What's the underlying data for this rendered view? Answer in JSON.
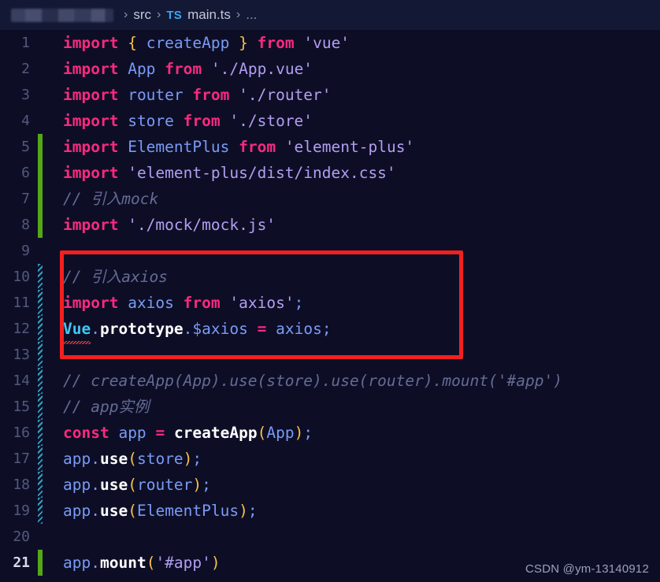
{
  "breadcrumb": {
    "redacted_label": "",
    "separator": "›",
    "folder": "src",
    "file_icon_label": "TS",
    "file": "main.ts",
    "overflow": "..."
  },
  "editor": {
    "language": "typescript",
    "active_line": 21,
    "lines": [
      {
        "n": "1",
        "gutter": "none",
        "tokens": [
          {
            "t": "import",
            "c": "kw"
          },
          {
            "t": " ",
            "c": "plain"
          },
          {
            "t": "{",
            "c": "brace"
          },
          {
            "t": " ",
            "c": "plain"
          },
          {
            "t": "createApp",
            "c": "ident"
          },
          {
            "t": " ",
            "c": "plain"
          },
          {
            "t": "}",
            "c": "brace"
          },
          {
            "t": " ",
            "c": "plain"
          },
          {
            "t": "from",
            "c": "kw"
          },
          {
            "t": " ",
            "c": "plain"
          },
          {
            "t": "'vue'",
            "c": "str"
          }
        ]
      },
      {
        "n": "2",
        "gutter": "none",
        "tokens": [
          {
            "t": "import",
            "c": "kw"
          },
          {
            "t": " ",
            "c": "plain"
          },
          {
            "t": "App",
            "c": "ident"
          },
          {
            "t": " ",
            "c": "plain"
          },
          {
            "t": "from",
            "c": "kw"
          },
          {
            "t": " ",
            "c": "plain"
          },
          {
            "t": "'./App.vue'",
            "c": "str"
          }
        ]
      },
      {
        "n": "3",
        "gutter": "none",
        "tokens": [
          {
            "t": "import",
            "c": "kw"
          },
          {
            "t": " ",
            "c": "plain"
          },
          {
            "t": "router",
            "c": "ident"
          },
          {
            "t": " ",
            "c": "plain"
          },
          {
            "t": "from",
            "c": "kw"
          },
          {
            "t": " ",
            "c": "plain"
          },
          {
            "t": "'./router'",
            "c": "str"
          }
        ]
      },
      {
        "n": "4",
        "gutter": "none",
        "tokens": [
          {
            "t": "import",
            "c": "kw"
          },
          {
            "t": " ",
            "c": "plain"
          },
          {
            "t": "store",
            "c": "ident"
          },
          {
            "t": " ",
            "c": "plain"
          },
          {
            "t": "from",
            "c": "kw"
          },
          {
            "t": " ",
            "c": "plain"
          },
          {
            "t": "'./store'",
            "c": "str"
          }
        ]
      },
      {
        "n": "5",
        "gutter": "added",
        "tokens": [
          {
            "t": "import",
            "c": "kw"
          },
          {
            "t": " ",
            "c": "plain"
          },
          {
            "t": "ElementPlus",
            "c": "ident"
          },
          {
            "t": " ",
            "c": "plain"
          },
          {
            "t": "from",
            "c": "kw"
          },
          {
            "t": " ",
            "c": "plain"
          },
          {
            "t": "'element-plus'",
            "c": "str"
          }
        ]
      },
      {
        "n": "6",
        "gutter": "added",
        "tokens": [
          {
            "t": "import",
            "c": "kw"
          },
          {
            "t": " ",
            "c": "plain"
          },
          {
            "t": "'element-plus/dist/index.css'",
            "c": "str"
          }
        ]
      },
      {
        "n": "7",
        "gutter": "added",
        "tokens": [
          {
            "t": "// 引入mock",
            "c": "comment"
          }
        ]
      },
      {
        "n": "8",
        "gutter": "added",
        "tokens": [
          {
            "t": "import",
            "c": "kw"
          },
          {
            "t": " ",
            "c": "plain"
          },
          {
            "t": "'./mock/mock.js'",
            "c": "str"
          }
        ]
      },
      {
        "n": "9",
        "gutter": "none",
        "tokens": []
      },
      {
        "n": "10",
        "gutter": "modified",
        "tokens": [
          {
            "t": "// 引入axios",
            "c": "comment"
          }
        ]
      },
      {
        "n": "11",
        "gutter": "modified",
        "tokens": [
          {
            "t": "import",
            "c": "kw"
          },
          {
            "t": " ",
            "c": "plain"
          },
          {
            "t": "axios",
            "c": "ident"
          },
          {
            "t": " ",
            "c": "plain"
          },
          {
            "t": "from",
            "c": "kw"
          },
          {
            "t": " ",
            "c": "plain"
          },
          {
            "t": "'axios'",
            "c": "str"
          },
          {
            "t": ";",
            "c": "punct"
          }
        ]
      },
      {
        "n": "12",
        "gutter": "modified",
        "tokens": [
          {
            "t": "Vue",
            "c": "cyan",
            "err": true
          },
          {
            "t": ".",
            "c": "punct"
          },
          {
            "t": "prototype",
            "c": "meth"
          },
          {
            "t": ".",
            "c": "punct"
          },
          {
            "t": "$axios",
            "c": "ident"
          },
          {
            "t": " ",
            "c": "plain"
          },
          {
            "t": "=",
            "c": "op"
          },
          {
            "t": " ",
            "c": "plain"
          },
          {
            "t": "axios",
            "c": "ident"
          },
          {
            "t": ";",
            "c": "punct"
          }
        ]
      },
      {
        "n": "13",
        "gutter": "modified",
        "tokens": []
      },
      {
        "n": "14",
        "gutter": "modified",
        "tokens": [
          {
            "t": "// createApp(App).use(store).use(router).mount('#app')",
            "c": "comment"
          }
        ]
      },
      {
        "n": "15",
        "gutter": "modified",
        "tokens": [
          {
            "t": "// app实例",
            "c": "comment"
          }
        ]
      },
      {
        "n": "16",
        "gutter": "modified",
        "tokens": [
          {
            "t": "const",
            "c": "kw"
          },
          {
            "t": " ",
            "c": "plain"
          },
          {
            "t": "app",
            "c": "ident"
          },
          {
            "t": " ",
            "c": "plain"
          },
          {
            "t": "=",
            "c": "op"
          },
          {
            "t": " ",
            "c": "plain"
          },
          {
            "t": "createApp",
            "c": "fn"
          },
          {
            "t": "(",
            "c": "paren"
          },
          {
            "t": "App",
            "c": "ident"
          },
          {
            "t": ")",
            "c": "paren"
          },
          {
            "t": ";",
            "c": "punct"
          }
        ]
      },
      {
        "n": "17",
        "gutter": "modified",
        "tokens": [
          {
            "t": "app",
            "c": "ident"
          },
          {
            "t": ".",
            "c": "punct"
          },
          {
            "t": "use",
            "c": "meth"
          },
          {
            "t": "(",
            "c": "paren"
          },
          {
            "t": "store",
            "c": "ident"
          },
          {
            "t": ")",
            "c": "paren"
          },
          {
            "t": ";",
            "c": "punct"
          }
        ]
      },
      {
        "n": "18",
        "gutter": "modified",
        "tokens": [
          {
            "t": "app",
            "c": "ident"
          },
          {
            "t": ".",
            "c": "punct"
          },
          {
            "t": "use",
            "c": "meth"
          },
          {
            "t": "(",
            "c": "paren"
          },
          {
            "t": "router",
            "c": "ident"
          },
          {
            "t": ")",
            "c": "paren"
          },
          {
            "t": ";",
            "c": "punct"
          }
        ]
      },
      {
        "n": "19",
        "gutter": "modified",
        "tokens": [
          {
            "t": "app",
            "c": "ident"
          },
          {
            "t": ".",
            "c": "punct"
          },
          {
            "t": "use",
            "c": "meth"
          },
          {
            "t": "(",
            "c": "paren"
          },
          {
            "t": "ElementPlus",
            "c": "ident"
          },
          {
            "t": ")",
            "c": "paren"
          },
          {
            "t": ";",
            "c": "punct"
          }
        ]
      },
      {
        "n": "20",
        "gutter": "none",
        "tokens": []
      },
      {
        "n": "21",
        "gutter": "added",
        "tokens": [
          {
            "t": "app",
            "c": "ident"
          },
          {
            "t": ".",
            "c": "punct"
          },
          {
            "t": "mount",
            "c": "meth"
          },
          {
            "t": "(",
            "c": "paren"
          },
          {
            "t": "'#app'",
            "c": "str"
          },
          {
            "t": ")",
            "c": "paren"
          }
        ]
      }
    ]
  },
  "annotation": {
    "shape": "rectangle",
    "color": "#f2201f",
    "covers_lines": "10-12"
  },
  "watermark": {
    "text": "CSDN @ym-13140912"
  },
  "theme": {
    "background": "#0d0e26",
    "breadcrumb_background": "#131835",
    "keyword": "#f92a7f",
    "string": "#b39ef0",
    "identifier": "#7a9bf5",
    "comment": "#656b93",
    "bracket": "#f6c344",
    "method": "#ffffff",
    "type_cyan": "#41c6f0",
    "gutter_added": "#54a716",
    "gutter_modified": "#2da3c4",
    "error_underline": "#e13b3b"
  }
}
